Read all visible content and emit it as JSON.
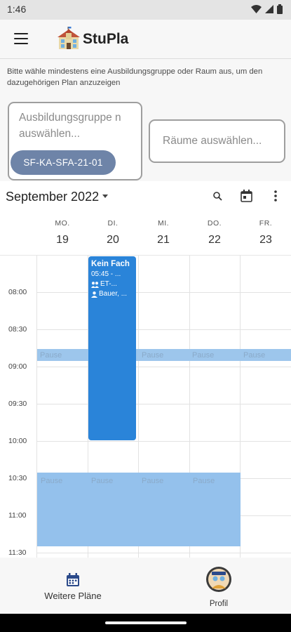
{
  "status_bar": {
    "time": "1:46",
    "icons": [
      "wifi-icon",
      "signal-icon",
      "battery-icon"
    ]
  },
  "app_bar": {
    "title": "StuPla",
    "menu_icon": "hamburger-menu-icon",
    "logo": "school-building-logo"
  },
  "filter": {
    "hint": "Bitte wähle mindestens eine Ausbildungsgruppe oder Raum aus, um den dazugehörigen Plan anzuzeigen",
    "group_placeholder": "Ausbildungsgruppe n auswählen...",
    "selected_group": "SF-KA-SFA-21-01",
    "room_placeholder": "Räume auswählen..."
  },
  "calendar": {
    "month": "September 2022",
    "days": [
      {
        "name": "MO.",
        "date": "19"
      },
      {
        "name": "DI.",
        "date": "20"
      },
      {
        "name": "MI.",
        "date": "21"
      },
      {
        "name": "DO.",
        "date": "22"
      },
      {
        "name": "FR.",
        "date": "23"
      }
    ],
    "times": [
      "08:00",
      "08:30",
      "09:00",
      "09:30",
      "10:00",
      "10:30",
      "11:00",
      "11:30"
    ],
    "pause_label": "Pause",
    "event": {
      "title": "Kein Fach",
      "time": "05:45 - ...",
      "group": "ET-...",
      "teacher": "Bauer, ..."
    }
  },
  "colors": {
    "event": "#2a84d9",
    "pause": "#94c1ec",
    "chip": "#6e84a8"
  },
  "bottom_nav": {
    "plans_label": "Weitere Pläne",
    "profile_label": "Profil"
  }
}
